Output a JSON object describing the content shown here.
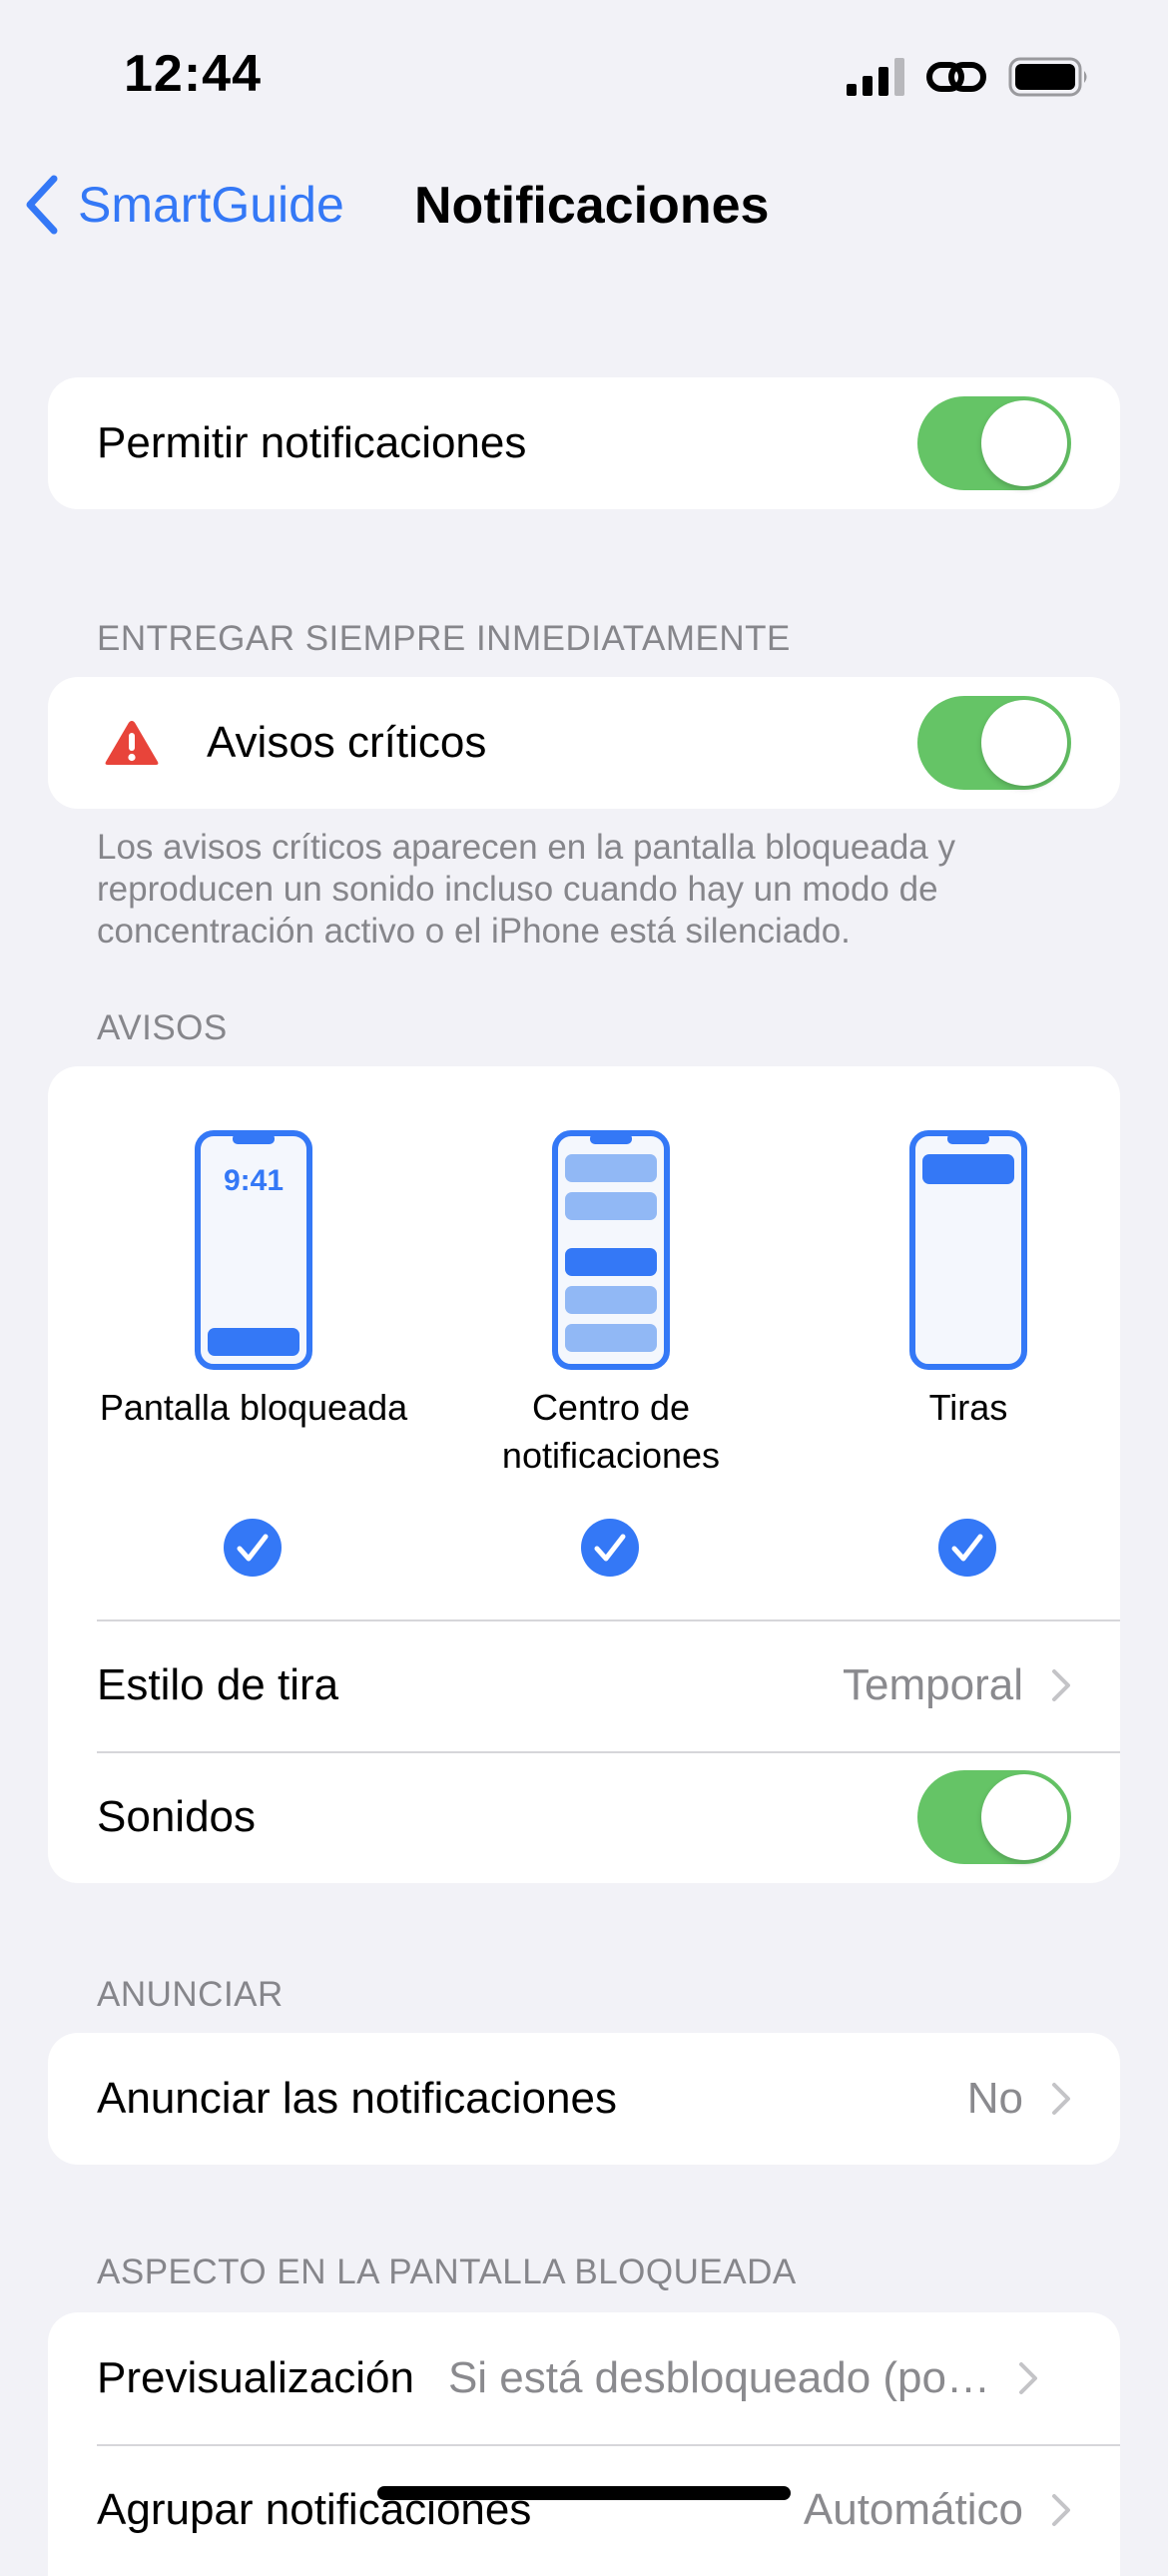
{
  "status_bar": {
    "time": "12:44"
  },
  "nav": {
    "back_label": "SmartGuide",
    "title": "Notificaciones"
  },
  "allow": {
    "label": "Permitir notificaciones",
    "enabled": true
  },
  "critical": {
    "header": "ENTREGAR SIEMPRE INMEDIATAMENTE",
    "label": "Avisos críticos",
    "enabled": true,
    "footer": "Los avisos críticos aparecen en la pantalla bloqueada y reproducen un sonido incluso cuando hay un modo de concentración activo o el iPhone está silenciado."
  },
  "alerts": {
    "header": "AVISOS",
    "styles": [
      {
        "label": "Pantalla bloqueada",
        "selected": true,
        "preview_time": "9:41"
      },
      {
        "label": "Centro de notificaciones",
        "selected": true
      },
      {
        "label": "Tiras",
        "selected": true
      }
    ],
    "banner_style": {
      "label": "Estilo de tira",
      "value": "Temporal"
    },
    "sounds": {
      "label": "Sonidos",
      "enabled": true
    }
  },
  "announce": {
    "header": "ANUNCIAR",
    "row": {
      "label": "Anunciar las notificaciones",
      "value": "No"
    }
  },
  "lock_screen": {
    "header": "ASPECTO EN LA PANTALLA BLOQUEADA",
    "preview": {
      "label": "Previsualización",
      "value": "Si está desbloqueado (po…"
    },
    "grouping": {
      "label": "Agrupar notificaciones",
      "value": "Automático"
    }
  },
  "colors": {
    "accent": "#3478f6",
    "toggle_on": "#65c466",
    "warning": "#e8443a",
    "background": "#f2f2f7"
  },
  "icons": [
    "back-chevron-icon",
    "cellular-signal-icon",
    "link-icon",
    "battery-icon",
    "warning-icon",
    "chevron-right-icon",
    "checkmark-icon"
  ]
}
